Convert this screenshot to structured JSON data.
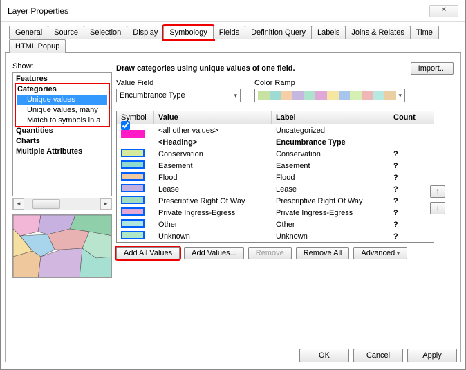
{
  "title": "Layer Properties",
  "tabs": [
    "General",
    "Source",
    "Selection",
    "Display",
    "Symbology",
    "Fields",
    "Definition Query",
    "Labels",
    "Joins & Relates",
    "Time",
    "HTML Popup"
  ],
  "active_tab": "Symbology",
  "show_label": "Show:",
  "tree": {
    "features": "Features",
    "categories": "Categories",
    "cat_items": [
      "Unique values",
      "Unique values, many",
      "Match to symbols in a"
    ],
    "quantities": "Quantities",
    "charts": "Charts",
    "multiple": "Multiple Attributes"
  },
  "desc": "Draw categories using unique values of one field.",
  "import_btn": "Import...",
  "value_field_label": "Value Field",
  "value_field": "Encumbrance Type",
  "color_ramp_label": "Color Ramp",
  "ramp_colors": [
    "#c7e2a3",
    "#9edbd2",
    "#f6cfa8",
    "#c6b7e1",
    "#aee2cd",
    "#e0a8d6",
    "#f5e7a1",
    "#a8c6ed",
    "#d6efb2",
    "#f0b7b7",
    "#b7e9e1",
    "#eacfa3"
  ],
  "grid_headers": {
    "symbol": "Symbol",
    "value": "Value",
    "label": "Label",
    "count": "Count"
  },
  "rows": [
    {
      "swatch": "#ff1ac6",
      "noborder": true,
      "checkbox": true,
      "value": "<all other values>",
      "label": "Uncategorized",
      "count": ""
    },
    {
      "heading": true,
      "value": "<Heading>",
      "label": "Encumbrance Type",
      "count": ""
    },
    {
      "swatch": "#d6ea9e",
      "value": "Conservation",
      "label": "Conservation",
      "count": "?"
    },
    {
      "swatch": "#8fd9cd",
      "value": "Easement",
      "label": "Easement",
      "count": "?"
    },
    {
      "swatch": "#f1c9a1",
      "value": "Flood",
      "label": "Flood",
      "count": "?"
    },
    {
      "swatch": "#c3b0e0",
      "value": "Lease",
      "label": "Lease",
      "count": "?"
    },
    {
      "swatch": "#a1dec1",
      "value": "Prescriptive Right Of Way",
      "label": "Prescriptive Right Of Way",
      "count": "?"
    },
    {
      "swatch": "#e5a8d5",
      "value": "Private Ingress-Egress",
      "label": "Private Ingress-Egress",
      "count": "?"
    },
    {
      "swatch": "#b1e6de",
      "value": "Other",
      "label": "Other",
      "count": "?"
    },
    {
      "swatch": "#aee8c6",
      "value": "Unknown",
      "label": "Unknown",
      "count": "?"
    }
  ],
  "actions": {
    "add_all": "Add All Values",
    "add_values": "Add Values...",
    "remove": "Remove",
    "remove_all": "Remove All",
    "advanced": "Advanced"
  },
  "move": {
    "up": "↑",
    "down": "↓"
  },
  "footer": {
    "ok": "OK",
    "cancel": "Cancel",
    "apply": "Apply"
  },
  "preview_colors": [
    "#f2b6d6",
    "#c7b1e0",
    "#8fcfa9",
    "#f5e0a1",
    "#a8d4ec",
    "#e9b2b2",
    "#b9e5cf",
    "#f0c89e",
    "#d2b8e0",
    "#a6e0d3"
  ]
}
